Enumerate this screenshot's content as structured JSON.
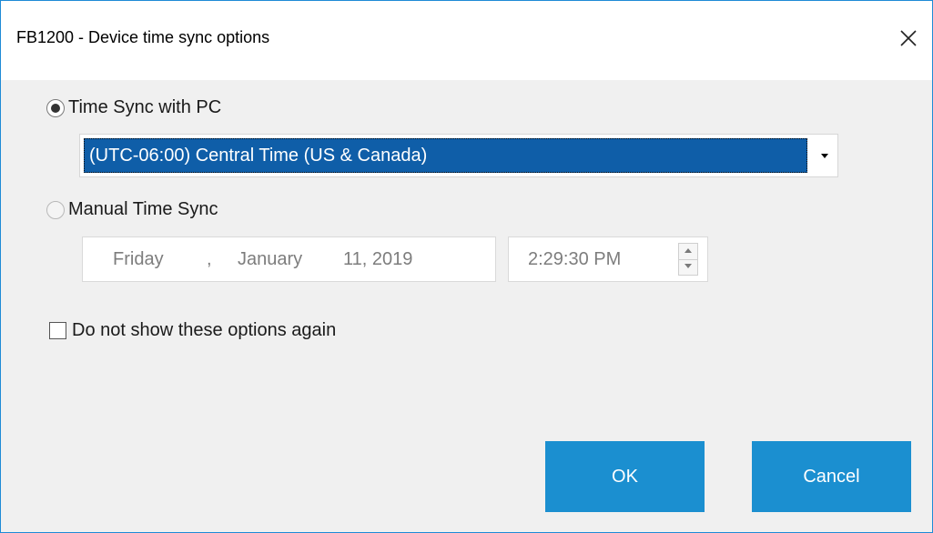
{
  "window": {
    "title": "FB1200 - Device time sync options",
    "close_icon": "close-icon"
  },
  "sync_pc": {
    "label": "Time Sync with PC",
    "selected": true,
    "timezone": "(UTC-06:00) Central Time (US & Canada)"
  },
  "manual": {
    "label": "Manual Time Sync",
    "selected": false,
    "date": {
      "weekday": "Friday",
      "sep": ",",
      "month": "January",
      "day_year": "11, 2019",
      "calendar_icon": "calendar-icon"
    },
    "time": "2:29:30 PM"
  },
  "dont_show": {
    "label": "Do not show these options again",
    "checked": false
  },
  "buttons": {
    "ok": "OK",
    "cancel": "Cancel"
  },
  "colors": {
    "accent": "#1b8fd0",
    "selection": "#0f5ea8",
    "window_border": "#1e8ad6"
  }
}
